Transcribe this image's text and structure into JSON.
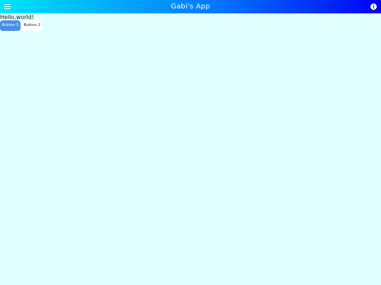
{
  "appbar": {
    "title": "Gabi's App",
    "menu_icon": "hamburger-menu-icon",
    "info_icon": "info-icon",
    "info_glyph": "i"
  },
  "main": {
    "greeting": "Hello,world!",
    "buttons": [
      {
        "label": "Button 1"
      },
      {
        "label": "Button 2"
      }
    ]
  },
  "colors": {
    "background": "#e0ffff",
    "appbar_gradient_start": "#00e5ff",
    "appbar_gradient_end": "#0000f0",
    "primary_button": "#4a90e8"
  }
}
